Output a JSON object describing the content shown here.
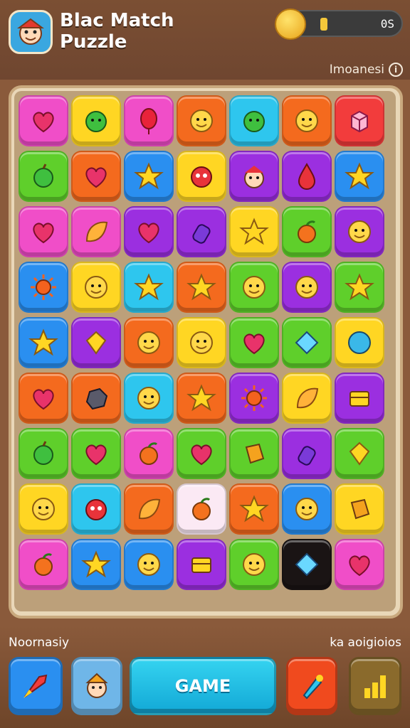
{
  "header": {
    "title_line1": "Blac Match",
    "title_line2": "Puzzle",
    "coin_count": "0S",
    "sub_label": "Imoanesi",
    "info_glyph": "i"
  },
  "colors": {
    "pink": "#f04ec8",
    "yellow": "#ffd623",
    "orange": "#f46a1e",
    "cyan": "#2ec6ee",
    "green": "#5fcf2b",
    "purple": "#9b2fe0",
    "red": "#f23c3c",
    "blue": "#2a8ff0",
    "black": "#1a1414",
    "white": "#fbe9f4"
  },
  "board": {
    "rows": [
      [
        {
          "bg": "pink",
          "icon": "heart-icon"
        },
        {
          "bg": "yellow",
          "icon": "blob-icon"
        },
        {
          "bg": "pink",
          "icon": "balloon-icon"
        },
        {
          "bg": "orange",
          "icon": "face-icon"
        },
        {
          "bg": "cyan",
          "icon": "blob-icon"
        },
        {
          "bg": "orange",
          "icon": "face-icon"
        },
        {
          "bg": "red",
          "icon": "cube-icon"
        }
      ],
      [
        {
          "bg": "green",
          "icon": "apple-icon"
        },
        {
          "bg": "orange",
          "icon": "heart-icon"
        },
        {
          "bg": "blue",
          "icon": "star-icon"
        },
        {
          "bg": "yellow",
          "icon": "monster-icon"
        },
        {
          "bg": "purple",
          "icon": "character-icon"
        },
        {
          "bg": "purple",
          "icon": "drop-icon"
        },
        {
          "bg": "blue",
          "icon": "star-icon"
        }
      ],
      [
        {
          "bg": "pink",
          "icon": "heart-icon"
        },
        {
          "bg": "pink",
          "icon": "leaf-icon"
        },
        {
          "bg": "purple",
          "icon": "heart-icon"
        },
        {
          "bg": "purple",
          "icon": "potion-icon"
        },
        {
          "bg": "yellow",
          "icon": "star-icon"
        },
        {
          "bg": "green",
          "icon": "fruit-icon"
        },
        {
          "bg": "purple",
          "icon": "face-icon"
        }
      ],
      [
        {
          "bg": "blue",
          "icon": "sun-icon"
        },
        {
          "bg": "yellow",
          "icon": "face-icon"
        },
        {
          "bg": "cyan",
          "icon": "star-icon"
        },
        {
          "bg": "orange",
          "icon": "star-icon"
        },
        {
          "bg": "green",
          "icon": "face-icon"
        },
        {
          "bg": "purple",
          "icon": "face-icon"
        },
        {
          "bg": "green",
          "icon": "star-icon"
        }
      ],
      [
        {
          "bg": "blue",
          "icon": "star-icon"
        },
        {
          "bg": "purple",
          "icon": "gem-icon"
        },
        {
          "bg": "orange",
          "icon": "face-icon"
        },
        {
          "bg": "yellow",
          "icon": "face-icon"
        },
        {
          "bg": "green",
          "icon": "heart-icon"
        },
        {
          "bg": "green",
          "icon": "diamond-icon"
        },
        {
          "bg": "yellow",
          "icon": "ball-icon"
        }
      ],
      [
        {
          "bg": "orange",
          "icon": "heart-icon"
        },
        {
          "bg": "orange",
          "icon": "rock-icon"
        },
        {
          "bg": "cyan",
          "icon": "face-icon"
        },
        {
          "bg": "orange",
          "icon": "star-icon"
        },
        {
          "bg": "purple",
          "icon": "sun-icon"
        },
        {
          "bg": "yellow",
          "icon": "leaf-icon"
        },
        {
          "bg": "purple",
          "icon": "chest-icon"
        }
      ],
      [
        {
          "bg": "green",
          "icon": "apple-icon"
        },
        {
          "bg": "green",
          "icon": "heart-icon"
        },
        {
          "bg": "pink",
          "icon": "fruit-icon"
        },
        {
          "bg": "green",
          "icon": "heart-icon"
        },
        {
          "bg": "green",
          "icon": "block-icon"
        },
        {
          "bg": "purple",
          "icon": "potion-icon"
        },
        {
          "bg": "green",
          "icon": "gem-icon"
        }
      ],
      [
        {
          "bg": "yellow",
          "icon": "face-icon"
        },
        {
          "bg": "cyan",
          "icon": "monster-icon"
        },
        {
          "bg": "orange",
          "icon": "leaf-icon"
        },
        {
          "bg": "white",
          "icon": "fruit-icon"
        },
        {
          "bg": "orange",
          "icon": "star-icon"
        },
        {
          "bg": "blue",
          "icon": "face-icon"
        },
        {
          "bg": "yellow",
          "icon": "block-icon"
        }
      ],
      [
        {
          "bg": "pink",
          "icon": "fruit-icon"
        },
        {
          "bg": "blue",
          "icon": "star-icon"
        },
        {
          "bg": "blue",
          "icon": "face-icon"
        },
        {
          "bg": "purple",
          "icon": "chest-icon"
        },
        {
          "bg": "green",
          "icon": "face-icon"
        },
        {
          "bg": "black",
          "icon": "diamond-icon"
        },
        {
          "bg": "pink",
          "icon": "heart-icon"
        }
      ]
    ]
  },
  "footer": {
    "left_label": "Noornasiy",
    "right_label": "ka aoigioios",
    "game_button": "GAME",
    "buttons": [
      {
        "name": "rocket-button",
        "icon": "rocket-icon",
        "bg": "#2a8ff0"
      },
      {
        "name": "character-button",
        "icon": "character-icon",
        "bg": "#6fb6e8"
      },
      {
        "name": "booster-button",
        "icon": "booster-icon",
        "bg": "#f04a1e"
      },
      {
        "name": "stats-button",
        "icon": "bar-chart-icon",
        "bg": "#8a6a2c"
      }
    ]
  }
}
